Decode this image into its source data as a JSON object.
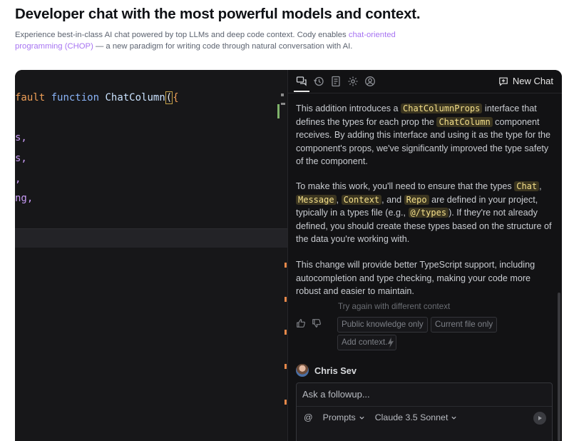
{
  "headline": "Developer chat with the most powerful models and context.",
  "subtext": {
    "before": "Experience best-in-class AI chat powered by top LLMs and deep code context. Cody enables ",
    "link": "chat-oriented programming (CHOP)",
    "after": " — a new paradigm for writing code through natural conversation with AI."
  },
  "editor": {
    "line1": {
      "kw": "fault",
      "kw2": "function",
      "name": "ChatColumn",
      "bracket": "(",
      "tail": "{"
    },
    "line2": "s,",
    "line3": "s,",
    "line4": ",",
    "line5": "ng,"
  },
  "toolbar": {
    "icons": [
      "chat-icon",
      "history-icon",
      "notebook-icon",
      "settings-icon",
      "account-icon"
    ],
    "new_chat": "New Chat"
  },
  "message": {
    "p1": {
      "t1": "This addition introduces a ",
      "c1": "ChatColumnProps",
      "t2": " interface that defines the types for each prop the ",
      "c2": "ChatColumn",
      "t3": " component receives. By adding this interface and using it as the type for the component's props, we've significantly improved the type safety of the component."
    },
    "p2": {
      "t1": "To make this work, you'll need to ensure that the types ",
      "c1": "Chat",
      "t2": ", ",
      "c2": "Message",
      "t3": ", ",
      "c3": "Context",
      "t4": ", and ",
      "c4": "Repo",
      "t5": " are defined in your project, typically in a types file (e.g., ",
      "c5": "@/types",
      "t6": "). If they're not already defined, you should create these types based on the structure of the data you're working with."
    },
    "p3": "This change will provide better TypeScript support, including autocompletion and type checking, making your code more robust and easier to maintain."
  },
  "suggestions": {
    "title": "Try again with different context",
    "public_knowledge": "Public knowledge only",
    "current_file": "Current file only",
    "add_context": "Add context..."
  },
  "author": {
    "name": "Chris Sev"
  },
  "followup": {
    "placeholder": "Ask a followup...",
    "mention_symbol": "@",
    "prompts": "Prompts",
    "model": "Claude 3.5 Sonnet"
  },
  "colors": {
    "accent_link": "#a774f2",
    "panel_bg": "#121214",
    "code_chip_bg": "#3b3520",
    "code_chip_text": "#f5e08a",
    "gutter_modified": "#e8894a"
  }
}
